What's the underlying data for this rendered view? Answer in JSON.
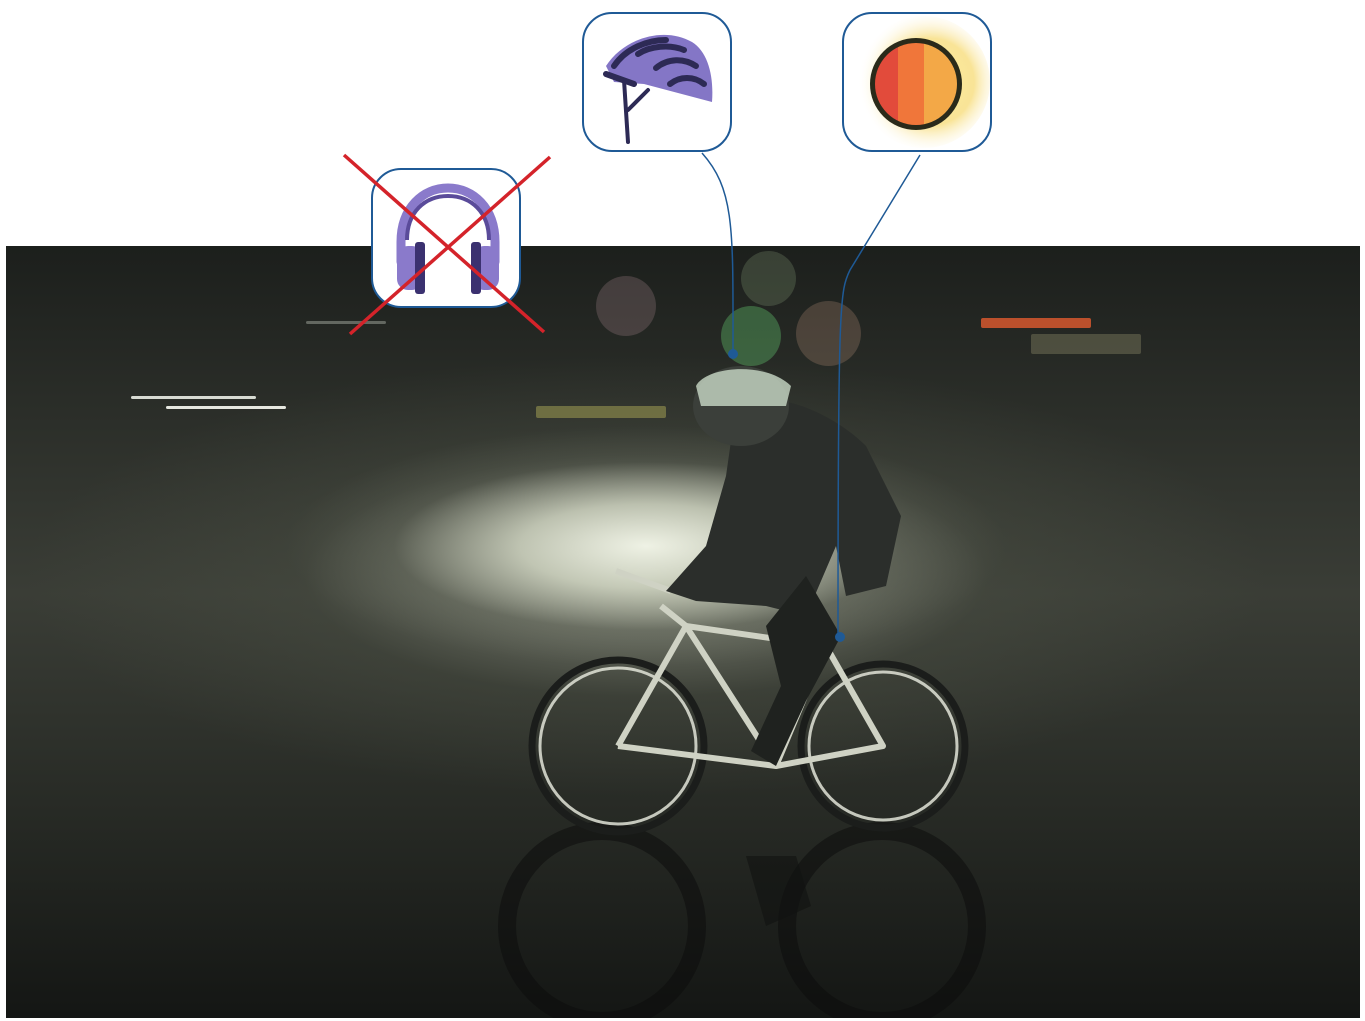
{
  "figure": {
    "icons": [
      {
        "id": "headphones",
        "icon": "headphones-icon",
        "status": "not-allowed",
        "mark": "red-x",
        "color": "#9b86cc"
      },
      {
        "id": "helmet",
        "icon": "bicycle-helmet-icon",
        "status": "recommended",
        "color": "#8476c6"
      },
      {
        "id": "light",
        "icon": "bike-light-icon",
        "status": "recommended",
        "color": "#f07a3a"
      }
    ],
    "colors": {
      "badge_border": "#1f5a96",
      "leader_line": "#1f5a96",
      "cross": "#d4232a",
      "icon_purple": "#8a7acb",
      "icon_dark": "#2d2a55"
    },
    "photo": "night-cyclist-motion-blur"
  }
}
